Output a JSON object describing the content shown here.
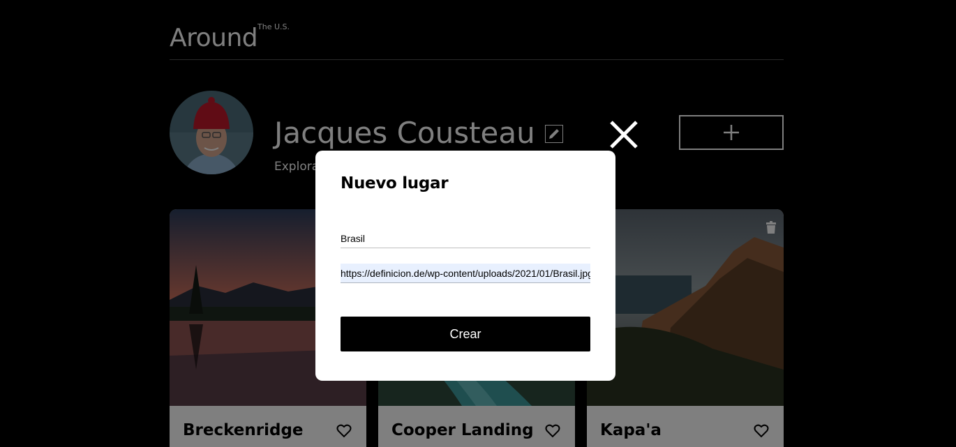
{
  "header": {
    "logo": "Around",
    "logo_sub": "The U.S."
  },
  "profile": {
    "name": "Jacques Cousteau",
    "about": "Explorador"
  },
  "cards": [
    {
      "title": "Breckenridge"
    },
    {
      "title": "Cooper Landing"
    },
    {
      "title": "Kapa'a"
    }
  ],
  "popup": {
    "title": "Nuevo lugar",
    "name_value": "Brasil",
    "url_value": "https://definicion.de/wp-content/uploads/2021/01/Brasil.jpg",
    "submit_label": "Crear"
  },
  "colors": {
    "page_bg": "#000000",
    "modal_bg": "#ffffff",
    "overlay": "rgba(0,0,0,0.5)",
    "button_bg": "#000000",
    "autofill_bg": "#e8f0fe"
  },
  "icons": {
    "edit": "pencil-icon",
    "add": "plus-icon",
    "like": "heart-outline-icon",
    "delete": "trash-icon",
    "close": "close-icon"
  }
}
